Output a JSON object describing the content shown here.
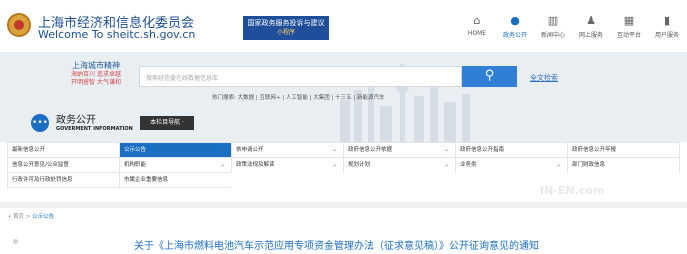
{
  "header": {
    "site_title_cn": "上海市经济和信息化委员会",
    "site_title_en": "Welcome To sheitc.sh.gov.cn",
    "promo_title": "国家政务服务投诉与建议",
    "promo_sub": "小程序",
    "nav": [
      {
        "label": "HOME",
        "icon": "home-icon"
      },
      {
        "label": "政务公开",
        "icon": "chat-icon",
        "active": true
      },
      {
        "label": "新闻中心",
        "icon": "book-icon"
      },
      {
        "label": "网上服务",
        "icon": "people-icon"
      },
      {
        "label": "互动平台",
        "icon": "grid-icon"
      },
      {
        "label": "用户服务",
        "icon": "building-icon"
      }
    ]
  },
  "banner": {
    "slogan_title": "上海城市精神",
    "slogan_line1": "海纳百川 追求卓越",
    "slogan_line2": "开明睿智 大气谦和",
    "search_placeholder": "搜索经信委在线数据信息库",
    "advanced_search": "全文检索",
    "hot_words": "热门搜索: 大数据 | 互联网+ | 人工智能 | 大集团 | 十三五 | 新能源汽车"
  },
  "section": {
    "title_cn": "政务公开",
    "title_en": "GOVERMENT INFORMATION",
    "column_nav": "本栏目导航 ·"
  },
  "grid_cells": [
    {
      "label": "最新信息公开",
      "dropdown": false
    },
    {
      "label": "公示公告",
      "dropdown": true,
      "active": true
    },
    {
      "label": "依申请公开",
      "dropdown": true
    },
    {
      "label": "政府信息公开依据",
      "dropdown": true
    },
    {
      "label": "政府信息公开指南",
      "dropdown": false
    },
    {
      "label": "政府信息公开年报",
      "dropdown": false
    },
    {
      "label": "信息公开意见/公众监督",
      "dropdown": false
    },
    {
      "label": "机构职能",
      "dropdown": true
    },
    {
      "label": "政策法规及解读",
      "dropdown": true
    },
    {
      "label": "规划计划",
      "dropdown": true
    },
    {
      "label": "业务类",
      "dropdown": true
    },
    {
      "label": "部门财政信息",
      "dropdown": false
    },
    {
      "label": "行政许可及行政处罚信息",
      "dropdown": false
    },
    {
      "label": "市属企业重要信息",
      "dropdown": false
    },
    {
      "label": "",
      "dropdown": false
    },
    {
      "label": "",
      "dropdown": false
    },
    {
      "label": "",
      "dropdown": false
    },
    {
      "label": "",
      "dropdown": false
    }
  ],
  "breadcrumb": {
    "home": "首页",
    "sep": " > ",
    "current": "公示公告"
  },
  "article_title": "关于《上海市燃料电池汽车示范应用专项资金管理办法（征求意见稿）》公开征询意见的通知",
  "watermark": "IN-EN.com",
  "colors": {
    "accent": "#1b6fc2",
    "search_button": "#2f7fd6"
  }
}
